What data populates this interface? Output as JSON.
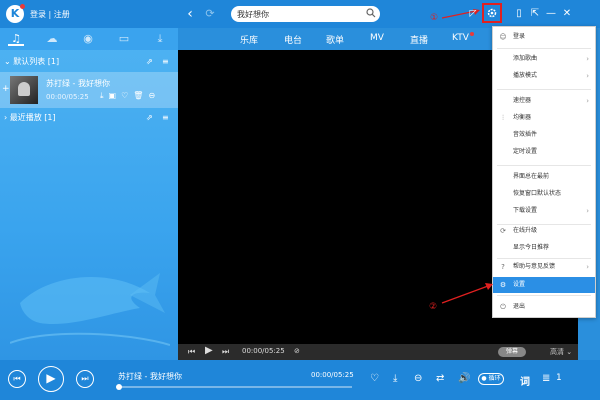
{
  "header": {
    "logo_text": "K",
    "login_text": "登录 | 注册",
    "search_value": "我好想你",
    "annotation_1": "①"
  },
  "left_panel": {
    "default_list": "默认列表 [1]",
    "recent_play": "最近播放 [1]",
    "song": {
      "title": "苏打绿 - 我好想你",
      "time": "00:00/05:25"
    }
  },
  "tabs": [
    "乐库",
    "电台",
    "歌单",
    "MV",
    "直播",
    "KTV"
  ],
  "video_controls": {
    "time": "00:00/05:25",
    "danmu": "弹幕",
    "quality": "高清 ⌄"
  },
  "menu": {
    "items": [
      {
        "icon": "user-icon",
        "label": "登录",
        "arrow": ""
      },
      {
        "icon": "",
        "label": "添加歌曲",
        "arrow": "›"
      },
      {
        "icon": "",
        "label": "播放模式",
        "arrow": "›"
      },
      {
        "icon": "",
        "label": "速控器",
        "arrow": "›"
      },
      {
        "icon": "equalizer-icon",
        "label": "均衡器",
        "arrow": ""
      },
      {
        "icon": "",
        "label": "音效插件",
        "arrow": ""
      },
      {
        "icon": "",
        "label": "定时设置",
        "arrow": ""
      },
      {
        "icon": "",
        "label": "界面总在最前",
        "arrow": ""
      },
      {
        "icon": "",
        "label": "恢复窗口默认状态",
        "arrow": ""
      },
      {
        "icon": "",
        "label": "下载设置",
        "arrow": "›"
      },
      {
        "icon": "upgrade-icon",
        "label": "在线升级",
        "arrow": ""
      },
      {
        "icon": "",
        "label": "显示今日推荐",
        "arrow": ""
      },
      {
        "icon": "help-icon",
        "label": "帮助与意见反馈",
        "arrow": "›"
      },
      {
        "icon": "gear-icon",
        "label": "设置",
        "arrow": ""
      },
      {
        "icon": "power-icon",
        "label": "退出",
        "arrow": ""
      }
    ]
  },
  "annotation_2": "②",
  "player": {
    "title": "苏打绿 - 我好想你",
    "time": "00:00/05:25",
    "loop_label": "● 循环",
    "lyrics_label": "词",
    "playlist_count": "1"
  },
  "colors": {
    "primary": "#1f86d9",
    "highlight": "#2b8fe5",
    "annotation": "#e02020"
  }
}
